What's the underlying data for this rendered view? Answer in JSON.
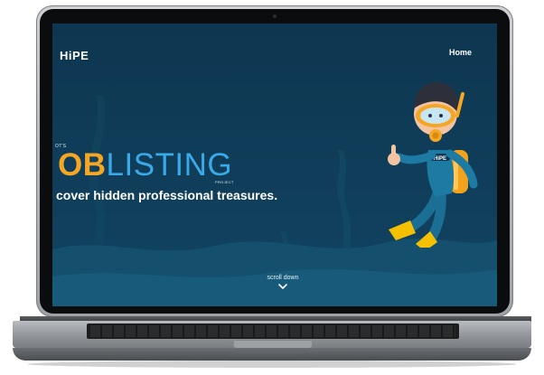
{
  "site": {
    "brand": "HiPE",
    "nav_home": "Home",
    "kicker": "OT'S",
    "title_ob": "OB",
    "title_listing": "LISTING",
    "project_label": "PROJECT",
    "tagline": "cover hidden professional treasures.",
    "scroll_label": "scroll down",
    "diver_badge": "HiPE"
  },
  "colors": {
    "screen_bg": "#0f3952",
    "accent_orange": "#f5a623",
    "accent_blue": "#39a9e8"
  },
  "icons": {
    "scroll": "chevron-down-icon",
    "illustration": "diver-illustration"
  }
}
